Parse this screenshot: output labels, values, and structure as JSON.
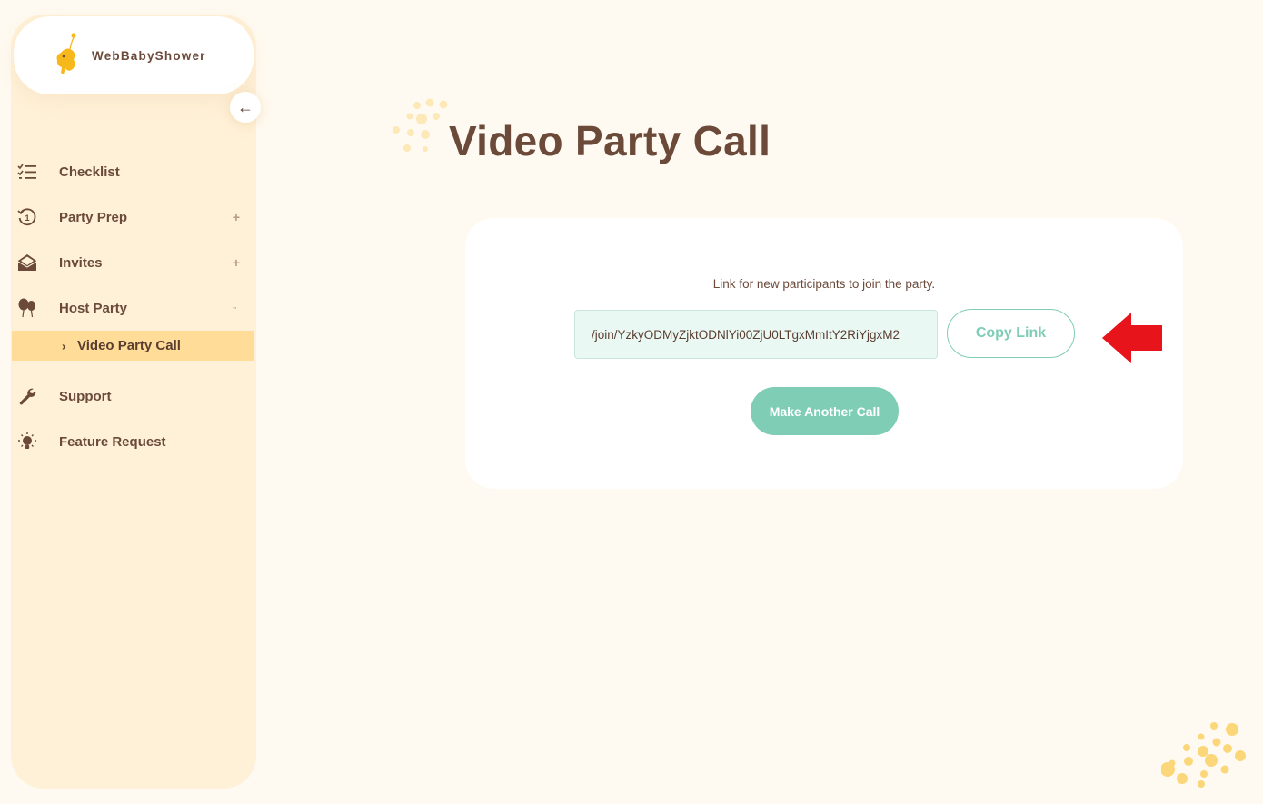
{
  "brand": {
    "name": "WebBabyShower"
  },
  "sidebar": {
    "collapse_glyph": "←",
    "items": [
      {
        "label": "Checklist",
        "icon": "checklist-icon"
      },
      {
        "label": "Party Prep",
        "icon": "history-icon",
        "toggle": "+"
      },
      {
        "label": "Invites",
        "icon": "envelope-open-icon",
        "toggle": "+"
      },
      {
        "label": "Host Party",
        "icon": "balloons-icon",
        "toggle": "··"
      },
      {
        "label": "Support",
        "icon": "wrench-icon"
      },
      {
        "label": "Feature Request",
        "icon": "lightbulb-icon"
      }
    ],
    "sub_items": [
      {
        "label": "Video Party Call",
        "chevron": "›"
      }
    ]
  },
  "main": {
    "title": "Video Party Call",
    "card": {
      "label": "Link for new participants to join the party.",
      "link_value": "/join/YzkyODMyZjktODNlYi00ZjU0LTgxMmItY2RiYjgxM2",
      "copy_button": "Copy Link",
      "another_button": "Make Another Call"
    }
  },
  "colors": {
    "background": "#fffaf1",
    "sidebar": "#fff1d8",
    "active_item": "#ffdd99",
    "text": "#6b4a3a",
    "accent": "#7fcdb5",
    "logo_yellow": "#f6b81a",
    "annotation_arrow": "#e8141c"
  }
}
